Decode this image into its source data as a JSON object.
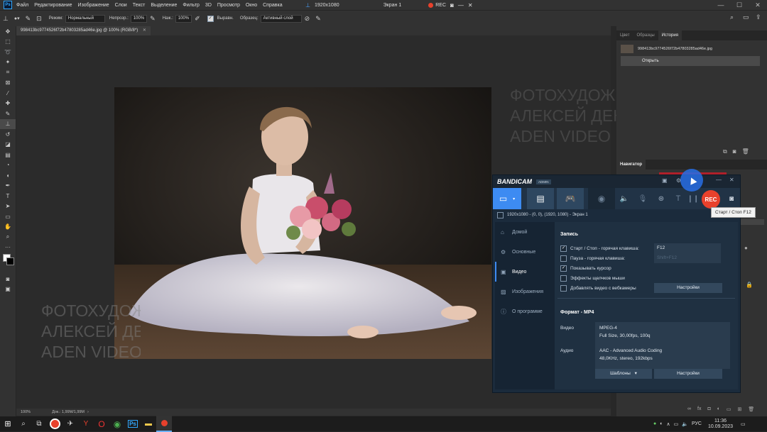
{
  "menubar": {
    "items": [
      "Файл",
      "Редактирование",
      "Изображение",
      "Слои",
      "Текст",
      "Выделение",
      "Фильтр",
      "3D",
      "Просмотр",
      "Окно",
      "Справка"
    ],
    "capture_resolution": "1920x1080",
    "capture_screen": "Экран 1",
    "rec_label": "REC"
  },
  "options": {
    "mode_label": "Режим:",
    "mode_value": "Нормальный",
    "opacity_label": "Непрозр.:",
    "opacity_value": "100%",
    "pressure_label": "Наж.:",
    "pressure_value": "100%",
    "align_label": "Выравн.",
    "sample_label": "Образец:",
    "sample_value": "Активный слой"
  },
  "document": {
    "tab_title": "998413bc9774526f72b47803285ad46e.jpg @ 100% (RGB/8*)",
    "zoom": "100%",
    "doc_info": "Док.: 1,99M/1,99M",
    "watermark": [
      "ФОТОХУДОЖНИК",
      "АЛЕКСЕЙ ДЕНИСОВ",
      "ADEN VIDEO"
    ]
  },
  "history_panel": {
    "tabs": [
      "Цвет",
      "Образцы",
      "История"
    ],
    "snapshot_name": "998413bc9774526f72b47803285ad46e.jpg",
    "step": "Открыть"
  },
  "navigator_panel": {
    "title": "Навигатор"
  },
  "bandicam": {
    "logo": "BANDICAM",
    "badge": "ADMIN",
    "rec_label": "REC",
    "tooltip": "Старт / Стоп  F12",
    "target": "1920x1080 - (0, 0), (1920, 1080) - Экран 1",
    "nav": [
      {
        "label": "Домой",
        "icon": "home-icon"
      },
      {
        "label": "Основные",
        "icon": "gear-icon"
      },
      {
        "label": "Видео",
        "icon": "video-icon"
      },
      {
        "label": "Изображения",
        "icon": "image-icon"
      },
      {
        "label": "О программе",
        "icon": "info-icon"
      }
    ],
    "record_section": "Запись",
    "options": [
      {
        "label": "Старт / Стоп - горячая клавиша:",
        "checked": true,
        "value": "F12"
      },
      {
        "label": "Пауза - горячая клавиша:",
        "checked": false,
        "value": "Shift+F12"
      },
      {
        "label": "Показывать курсор",
        "checked": true
      },
      {
        "label": "Эффекты щелчков мыши",
        "checked": false
      },
      {
        "label": "Добавлять видео с вебкамеры",
        "checked": false
      }
    ],
    "settings_button": "Настройки",
    "format_section": "Формат - MP4",
    "video_label": "Видео",
    "video_codec": "MPEG-4",
    "video_params": "Full Size, 30,00fps, 100q",
    "audio_label": "Аудио",
    "audio_codec": "AAC - Advanced Audio Coding",
    "audio_params": "48,0KHz, stereo, 192kbps",
    "templates_button": "Шаблоны",
    "settings_button2": "Настройки"
  },
  "taskbar": {
    "lang": "РУС",
    "time": "11:36",
    "date": "10.09.2023"
  },
  "colors": {
    "ps_bg": "#323232",
    "bandicam_blue": "#3d8bf2",
    "rec_red": "#e8412c"
  }
}
